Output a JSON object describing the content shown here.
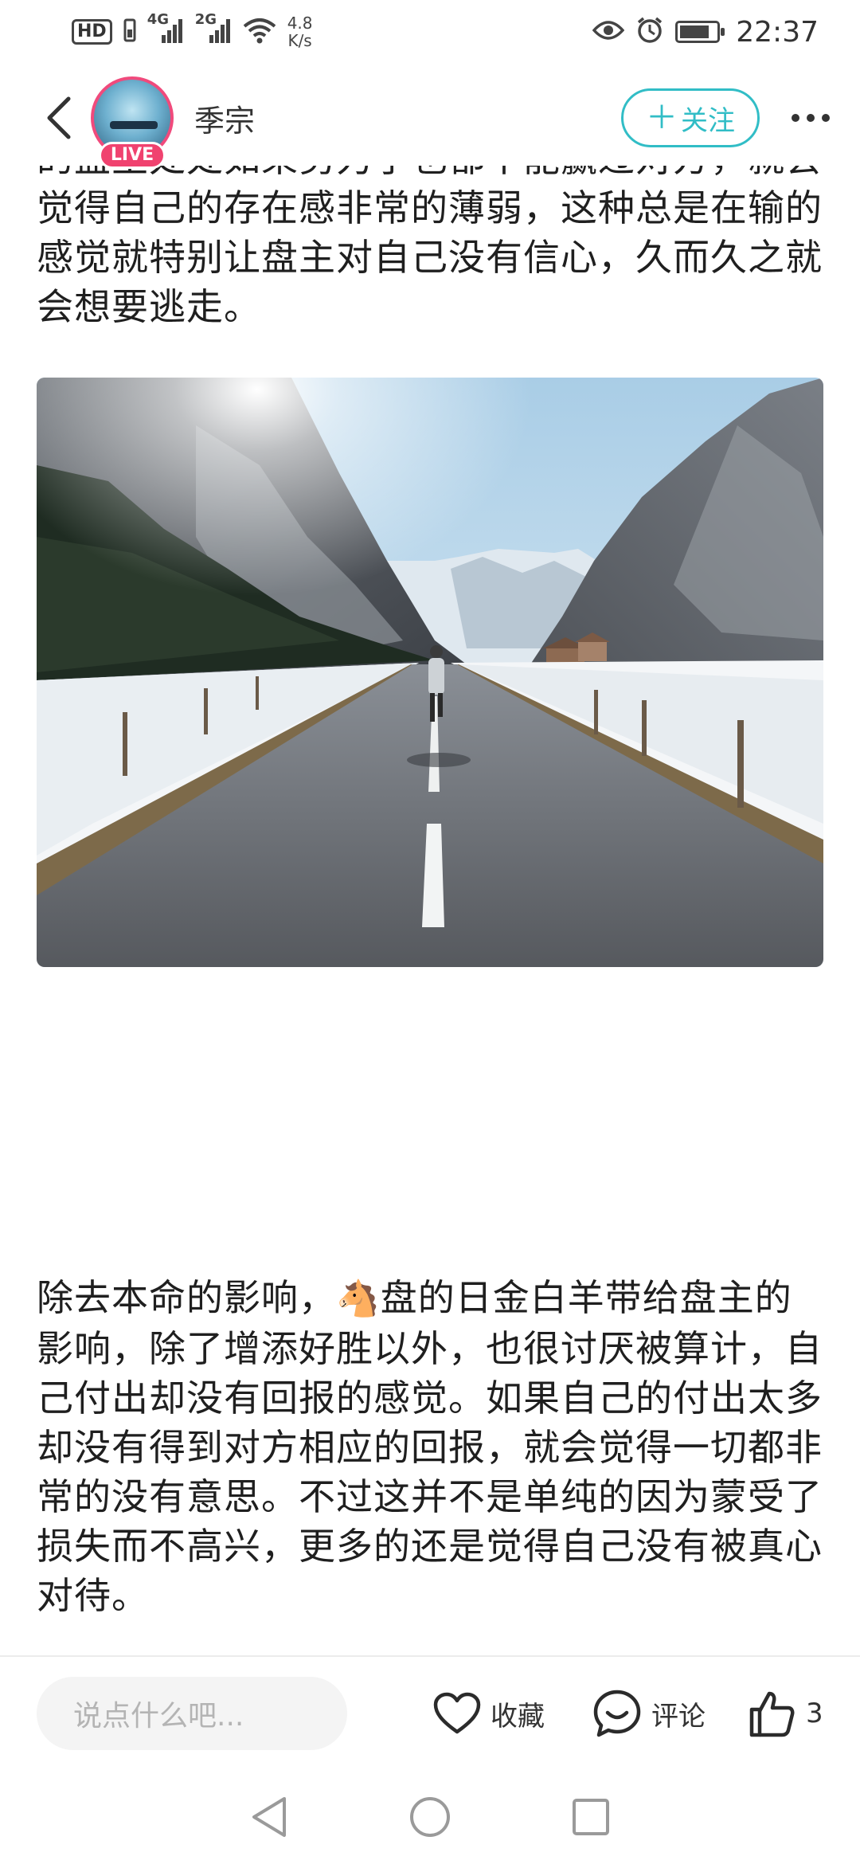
{
  "status_bar": {
    "hd_badge": "HD",
    "sim1_label": "4G",
    "sim2_label": "2G",
    "speed_value": "4.8",
    "speed_unit": "K/s",
    "time": "22:37"
  },
  "header": {
    "author_name": "季宗",
    "live_badge": "LIVE",
    "follow_label": "关注"
  },
  "article": {
    "para_top": "的盘主处处如果努力了也都不能赢过对方，就会觉得自己的存在感非常的薄弱，这种总是在输的感觉就特别让盘主对自己没有信心，久而久之就会想要逃走。",
    "para_bottom_a": "除去本命的影响，",
    "horse_emoji": "🐴",
    "para_bottom_b": "盘的日金白羊带给盘主的影响，除了增添好胜以外，也很讨厌被算计，自己付出却没有回报的感觉。如果自己的付出太多却没有得到对方相应的回报，就会觉得一切都非常的没有意思。不过这并不是单纯的因为蒙受了损失而不高兴，更多的还是觉得自己没有被真心对待。"
  },
  "bottom_bar": {
    "comment_placeholder": "说点什么吧...",
    "favorite_label": "收藏",
    "comment_label": "评论",
    "like_count": "3"
  },
  "colors": {
    "accent": "#31bdc6",
    "live": "#f0426f",
    "text": "#1f1f1f"
  }
}
